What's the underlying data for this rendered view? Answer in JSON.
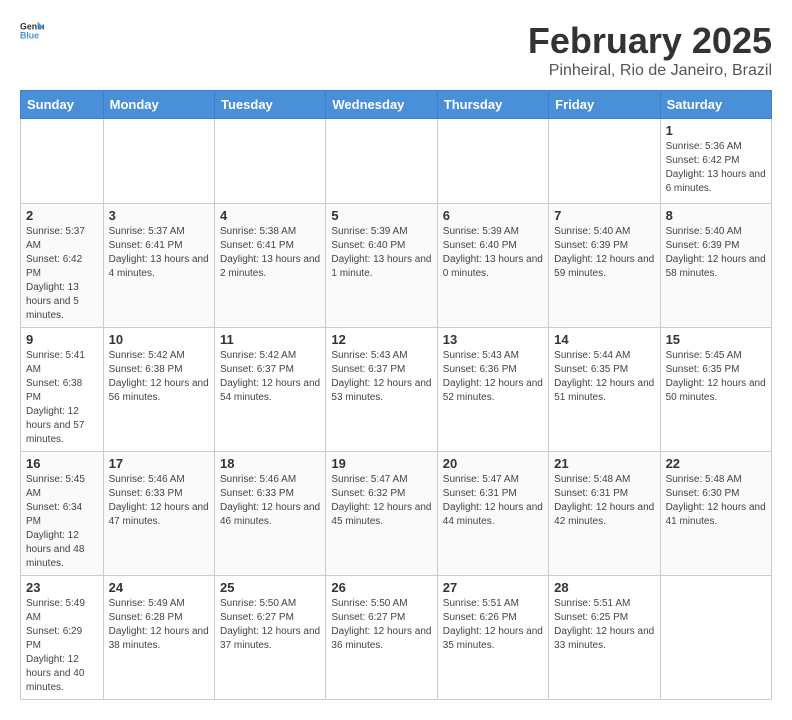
{
  "header": {
    "logo_general": "General",
    "logo_blue": "Blue",
    "title": "February 2025",
    "subtitle": "Pinheiral, Rio de Janeiro, Brazil"
  },
  "weekdays": [
    "Sunday",
    "Monday",
    "Tuesday",
    "Wednesday",
    "Thursday",
    "Friday",
    "Saturday"
  ],
  "weeks": [
    [
      {
        "day": "",
        "info": ""
      },
      {
        "day": "",
        "info": ""
      },
      {
        "day": "",
        "info": ""
      },
      {
        "day": "",
        "info": ""
      },
      {
        "day": "",
        "info": ""
      },
      {
        "day": "",
        "info": ""
      },
      {
        "day": "1",
        "info": "Sunrise: 5:36 AM\nSunset: 6:42 PM\nDaylight: 13 hours and 6 minutes."
      }
    ],
    [
      {
        "day": "2",
        "info": "Sunrise: 5:37 AM\nSunset: 6:42 PM\nDaylight: 13 hours and 5 minutes."
      },
      {
        "day": "3",
        "info": "Sunrise: 5:37 AM\nSunset: 6:41 PM\nDaylight: 13 hours and 4 minutes."
      },
      {
        "day": "4",
        "info": "Sunrise: 5:38 AM\nSunset: 6:41 PM\nDaylight: 13 hours and 2 minutes."
      },
      {
        "day": "5",
        "info": "Sunrise: 5:39 AM\nSunset: 6:40 PM\nDaylight: 13 hours and 1 minute."
      },
      {
        "day": "6",
        "info": "Sunrise: 5:39 AM\nSunset: 6:40 PM\nDaylight: 13 hours and 0 minutes."
      },
      {
        "day": "7",
        "info": "Sunrise: 5:40 AM\nSunset: 6:39 PM\nDaylight: 12 hours and 59 minutes."
      },
      {
        "day": "8",
        "info": "Sunrise: 5:40 AM\nSunset: 6:39 PM\nDaylight: 12 hours and 58 minutes."
      }
    ],
    [
      {
        "day": "9",
        "info": "Sunrise: 5:41 AM\nSunset: 6:38 PM\nDaylight: 12 hours and 57 minutes."
      },
      {
        "day": "10",
        "info": "Sunrise: 5:42 AM\nSunset: 6:38 PM\nDaylight: 12 hours and 56 minutes."
      },
      {
        "day": "11",
        "info": "Sunrise: 5:42 AM\nSunset: 6:37 PM\nDaylight: 12 hours and 54 minutes."
      },
      {
        "day": "12",
        "info": "Sunrise: 5:43 AM\nSunset: 6:37 PM\nDaylight: 12 hours and 53 minutes."
      },
      {
        "day": "13",
        "info": "Sunrise: 5:43 AM\nSunset: 6:36 PM\nDaylight: 12 hours and 52 minutes."
      },
      {
        "day": "14",
        "info": "Sunrise: 5:44 AM\nSunset: 6:35 PM\nDaylight: 12 hours and 51 minutes."
      },
      {
        "day": "15",
        "info": "Sunrise: 5:45 AM\nSunset: 6:35 PM\nDaylight: 12 hours and 50 minutes."
      }
    ],
    [
      {
        "day": "16",
        "info": "Sunrise: 5:45 AM\nSunset: 6:34 PM\nDaylight: 12 hours and 48 minutes."
      },
      {
        "day": "17",
        "info": "Sunrise: 5:46 AM\nSunset: 6:33 PM\nDaylight: 12 hours and 47 minutes."
      },
      {
        "day": "18",
        "info": "Sunrise: 5:46 AM\nSunset: 6:33 PM\nDaylight: 12 hours and 46 minutes."
      },
      {
        "day": "19",
        "info": "Sunrise: 5:47 AM\nSunset: 6:32 PM\nDaylight: 12 hours and 45 minutes."
      },
      {
        "day": "20",
        "info": "Sunrise: 5:47 AM\nSunset: 6:31 PM\nDaylight: 12 hours and 44 minutes."
      },
      {
        "day": "21",
        "info": "Sunrise: 5:48 AM\nSunset: 6:31 PM\nDaylight: 12 hours and 42 minutes."
      },
      {
        "day": "22",
        "info": "Sunrise: 5:48 AM\nSunset: 6:30 PM\nDaylight: 12 hours and 41 minutes."
      }
    ],
    [
      {
        "day": "23",
        "info": "Sunrise: 5:49 AM\nSunset: 6:29 PM\nDaylight: 12 hours and 40 minutes."
      },
      {
        "day": "24",
        "info": "Sunrise: 5:49 AM\nSunset: 6:28 PM\nDaylight: 12 hours and 38 minutes."
      },
      {
        "day": "25",
        "info": "Sunrise: 5:50 AM\nSunset: 6:27 PM\nDaylight: 12 hours and 37 minutes."
      },
      {
        "day": "26",
        "info": "Sunrise: 5:50 AM\nSunset: 6:27 PM\nDaylight: 12 hours and 36 minutes."
      },
      {
        "day": "27",
        "info": "Sunrise: 5:51 AM\nSunset: 6:26 PM\nDaylight: 12 hours and 35 minutes."
      },
      {
        "day": "28",
        "info": "Sunrise: 5:51 AM\nSunset: 6:25 PM\nDaylight: 12 hours and 33 minutes."
      },
      {
        "day": "",
        "info": ""
      }
    ]
  ]
}
